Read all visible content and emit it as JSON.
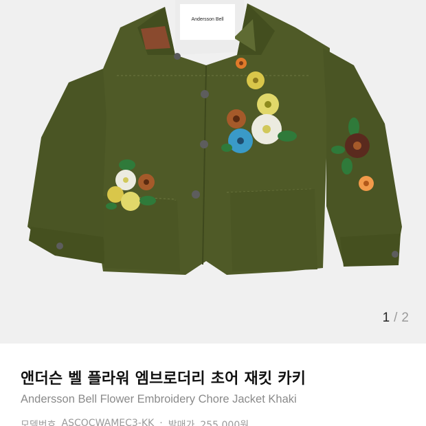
{
  "product": {
    "image_alt": "Andersson Bell Flower Embroidery Chore Jacket Khaki",
    "label_text": "Andersson Bell",
    "colors": {
      "jacket": "#4f5a27",
      "jacket_shadow": "#3e481d",
      "background": "#f0f0f0"
    }
  },
  "pager": {
    "current": "1",
    "separator": "/",
    "total": "2"
  },
  "title_ko": "앤더슨 벨 플라워 엠브로더리 초어 재킷 카키",
  "title_en": "Andersson Bell Flower Embroidery Chore Jacket Khaki",
  "meta": {
    "model_label": "모델번호",
    "model_value": "ASCOCWAMEC3-KK",
    "divider": "·",
    "price_label": "발매가",
    "price_value": "255,000원"
  }
}
